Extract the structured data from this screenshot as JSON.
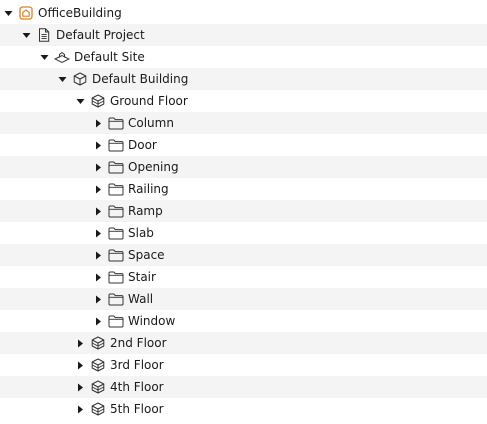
{
  "tree": {
    "nodes": [
      {
        "label": "OfficeBuilding",
        "level": 0,
        "expanded": true,
        "icon": "project-home-icon"
      },
      {
        "label": "Default Project",
        "level": 1,
        "expanded": true,
        "icon": "document-icon"
      },
      {
        "label": "Default Site",
        "level": 2,
        "expanded": true,
        "icon": "site-icon"
      },
      {
        "label": "Default Building",
        "level": 3,
        "expanded": true,
        "icon": "building-icon"
      },
      {
        "label": "Ground Floor",
        "level": 4,
        "expanded": true,
        "icon": "storey-icon"
      },
      {
        "label": "Column",
        "level": 5,
        "expanded": false,
        "icon": "folder-icon"
      },
      {
        "label": "Door",
        "level": 5,
        "expanded": false,
        "icon": "folder-icon"
      },
      {
        "label": "Opening",
        "level": 5,
        "expanded": false,
        "icon": "folder-icon"
      },
      {
        "label": "Railing",
        "level": 5,
        "expanded": false,
        "icon": "folder-icon"
      },
      {
        "label": "Ramp",
        "level": 5,
        "expanded": false,
        "icon": "folder-icon"
      },
      {
        "label": "Slab",
        "level": 5,
        "expanded": false,
        "icon": "folder-icon"
      },
      {
        "label": "Space",
        "level": 5,
        "expanded": false,
        "icon": "folder-icon"
      },
      {
        "label": "Stair",
        "level": 5,
        "expanded": false,
        "icon": "folder-icon"
      },
      {
        "label": "Wall",
        "level": 5,
        "expanded": false,
        "icon": "folder-icon"
      },
      {
        "label": "Window",
        "level": 5,
        "expanded": false,
        "icon": "folder-icon"
      },
      {
        "label": "2nd Floor",
        "level": 4,
        "expanded": false,
        "icon": "storey-icon"
      },
      {
        "label": "3rd Floor",
        "level": 4,
        "expanded": false,
        "icon": "storey-icon"
      },
      {
        "label": "4th Floor",
        "level": 4,
        "expanded": false,
        "icon": "storey-icon"
      },
      {
        "label": "5th Floor",
        "level": 4,
        "expanded": false,
        "icon": "storey-icon"
      }
    ]
  },
  "colors": {
    "row_alternate": "#f4f4f4",
    "text": "#1a1a1a",
    "toggle_arrow": "#1a1a1a",
    "project_icon": "#d9822b",
    "icon_stroke": "#333333"
  }
}
